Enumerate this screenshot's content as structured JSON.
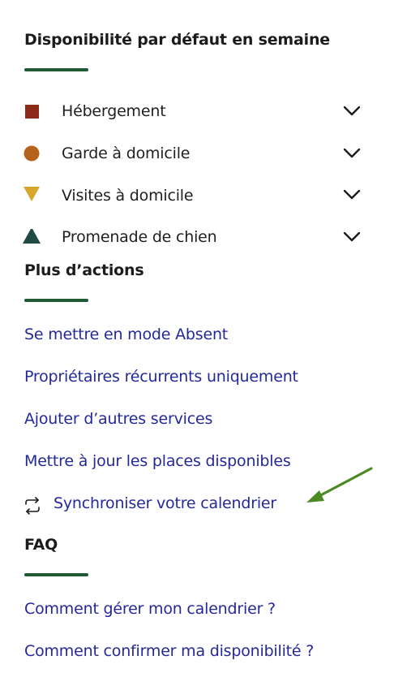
{
  "colors": {
    "accent_green": "#1f5a34",
    "link_blue": "#23299a",
    "arrow_green": "#4a8a20",
    "hebergement": "#8c2a1a",
    "garde": "#b5621a",
    "visites": "#d6a72a",
    "promenade": "#1f4a45"
  },
  "availability": {
    "heading": "Disponibilité par défaut en semaine",
    "services": [
      {
        "label": "Hébergement",
        "icon": "square-icon"
      },
      {
        "label": "Garde à domicile",
        "icon": "circle-icon"
      },
      {
        "label": "Visites à domicile",
        "icon": "triangle-down-icon"
      },
      {
        "label": "Promenade de chien",
        "icon": "triangle-up-icon"
      }
    ]
  },
  "actions": {
    "heading": "Plus d’actions",
    "links": [
      "Se mettre en mode Absent",
      "Propriétaires récurrents uniquement",
      "Ajouter d’autres services",
      "Mettre à jour les places disponibles"
    ],
    "sync_label": "Synchroniser votre calendrier",
    "sync_icon": "sync-icon"
  },
  "faq": {
    "heading": "FAQ",
    "links": [
      "Comment gérer mon calendrier ?",
      "Comment confirmer ma disponibilité ?"
    ]
  }
}
